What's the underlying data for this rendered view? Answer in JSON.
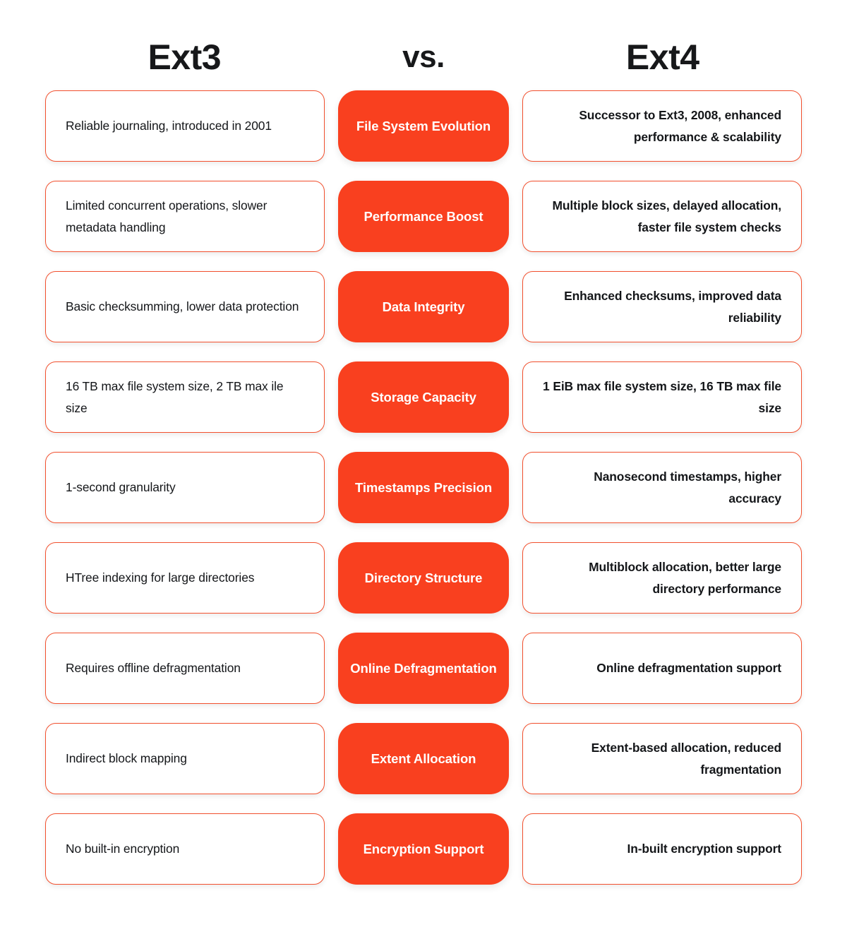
{
  "theme": {
    "accent": "#f9401f",
    "card_border": "#f2502e",
    "text": "#141619",
    "heading": "#17181a",
    "background": "#ffffff"
  },
  "header": {
    "left_title": "Ext3",
    "center_title": "vs.",
    "right_title": "Ext4"
  },
  "rows": [
    {
      "left": "Reliable journaling, introduced in 2001",
      "label": "File System Evolution",
      "right": "Successor to Ext3, 2008, enhanced performance & scalability"
    },
    {
      "left": "Limited concurrent operations, slower metadata handling",
      "label": "Performance Boost",
      "right": "Multiple block sizes, delayed allocation, faster file system checks"
    },
    {
      "left": "Basic checksumming, lower data protection",
      "label": "Data Integrity",
      "right": "Enhanced checksums, improved data reliability"
    },
    {
      "left": "16 TB max file system size, 2 TB max ile size",
      "label": "Storage Capacity",
      "right": "1 EiB max file system size, 16 TB max file size"
    },
    {
      "left": "1-second granularity",
      "label": "Timestamps Precision",
      "right": "Nanosecond timestamps, higher accuracy"
    },
    {
      "left": "HTree indexing for large directories",
      "label": "Directory Structure",
      "right": "Multiblock allocation, better large directory performance"
    },
    {
      "left": "Requires offline defragmentation",
      "label": "Online Defragmentation",
      "right": "Online defragmentation support"
    },
    {
      "left": "Indirect block mapping",
      "label": "Extent Allocation",
      "right": "Extent-based allocation, reduced fragmentation"
    },
    {
      "left": "No built-in encryption",
      "label": "Encryption Support",
      "right": "In-built encryption support"
    }
  ]
}
